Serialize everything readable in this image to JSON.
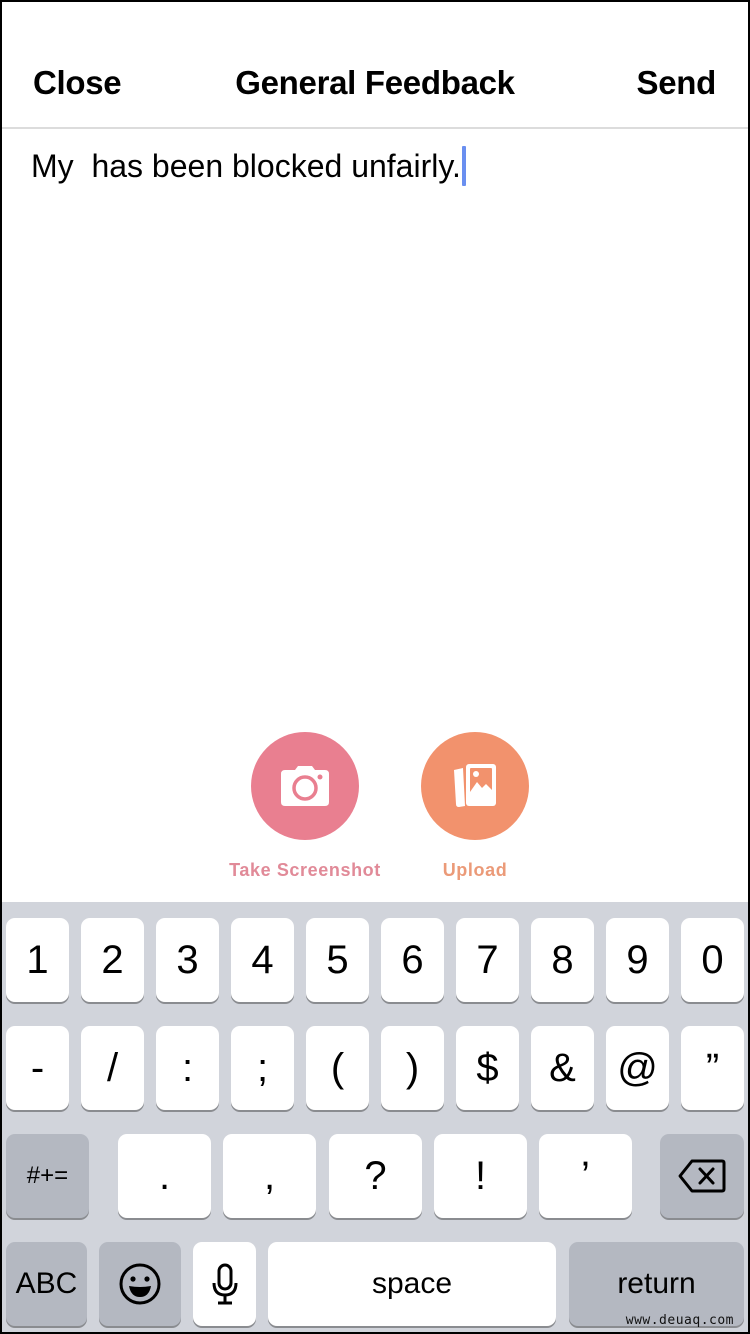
{
  "navbar": {
    "close_label": "Close",
    "title": "General Feedback",
    "send_label": "Send"
  },
  "feedback": {
    "text": "My  has been blocked unfairly.",
    "cursor_color": "#6a8ff0"
  },
  "actions": {
    "screenshot": {
      "label": "Take Screenshot",
      "icon": "camera-icon",
      "color": "#e97f90"
    },
    "upload": {
      "label": "Upload",
      "icon": "photos-icon",
      "color": "#f2926d"
    }
  },
  "keyboard": {
    "row1": [
      "1",
      "2",
      "3",
      "4",
      "5",
      "6",
      "7",
      "8",
      "9",
      "0"
    ],
    "row2": [
      "-",
      "/",
      ":",
      ";",
      "(",
      ")",
      "$",
      "&",
      "@",
      "”"
    ],
    "row3": {
      "shift_label": "#+=",
      "keys": [
        ".",
        ",",
        "?",
        "!",
        "’"
      ],
      "delete_icon": "backspace-icon"
    },
    "row4": {
      "abc_label": "ABC",
      "emoji_icon": "emoji-icon",
      "mic_icon": "microphone-icon",
      "space_label": "space",
      "return_label": "return"
    }
  },
  "watermark": "www.deuaq.com"
}
